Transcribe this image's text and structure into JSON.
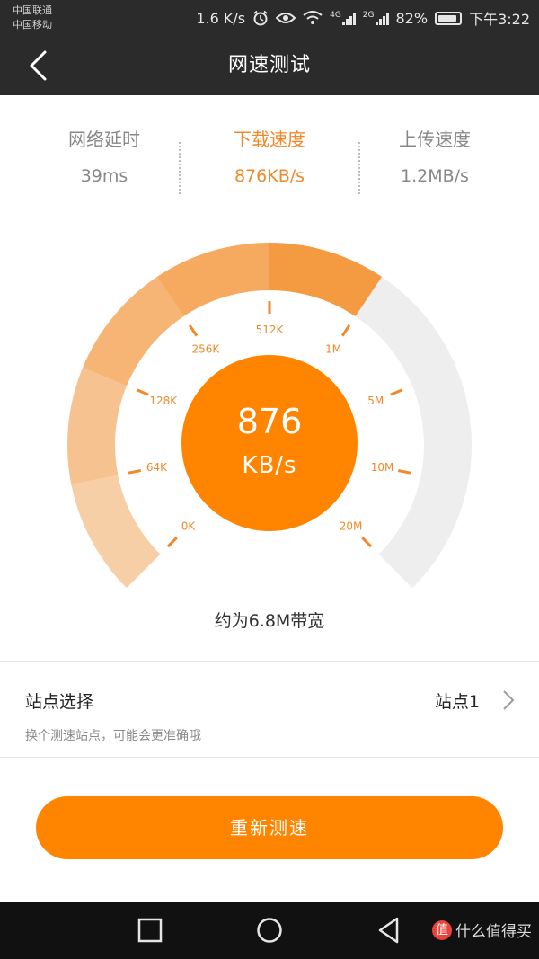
{
  "status_bar": {
    "carrier1": "中国联通",
    "carrier2": "中国移动",
    "net_speed": "1.6 K/s",
    "alarm_icon": "alarm-icon",
    "eye_icon": "eye-icon",
    "wifi_icon": "wifi-icon",
    "net1": "4G",
    "net2": "2G",
    "battery": "82%",
    "time": "下午3:22"
  },
  "header": {
    "back_icon": "back-arrow-icon",
    "title": "网速测试"
  },
  "stats": {
    "latency": {
      "label": "网络延时",
      "value": "39ms"
    },
    "download": {
      "label": "下载速度",
      "value": "876KB/s"
    },
    "upload": {
      "label": "上传速度",
      "value": "1.2MB/s"
    }
  },
  "gauge": {
    "ticks": [
      "0K",
      "64K",
      "128K",
      "256K",
      "512K",
      "1M",
      "5M",
      "10M",
      "20M"
    ],
    "level_fraction": 0.625,
    "center_value": "876",
    "center_unit": "KB/s",
    "colors": {
      "segments": [
        "#f6cfa6",
        "#f6c290",
        "#f6b475",
        "#f6aa60",
        "#f49a40"
      ],
      "remaining": "#eeeeee",
      "accent": "#ff8400",
      "text_accent": "#f0892a"
    }
  },
  "bandwidth_text": "约为6.8M带宽",
  "site": {
    "title": "站点选择",
    "hint": "换个测速站点，可能会更准确哦",
    "value": "站点1",
    "chevron_icon": "chevron-right-icon"
  },
  "retest_button": "重新测速",
  "nav": {
    "recent_icon": "square-recent-apps-icon",
    "home_icon": "circle-home-icon",
    "back_icon": "triangle-back-icon"
  },
  "watermark": {
    "logo": "值",
    "text": "什么值得买"
  }
}
